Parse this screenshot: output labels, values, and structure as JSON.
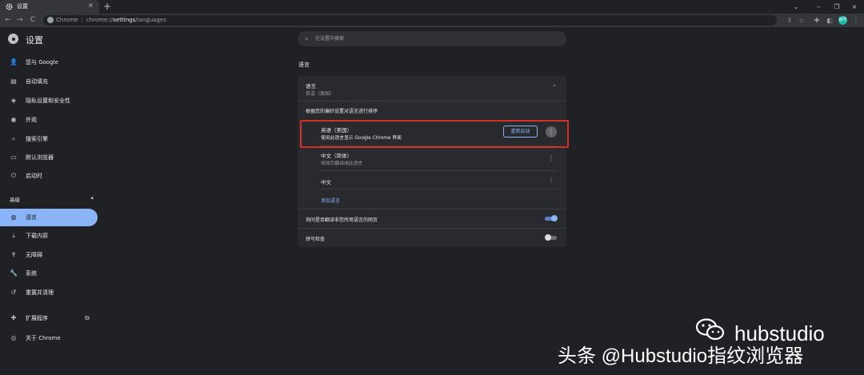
{
  "tab": {
    "title": "设置",
    "close": "×",
    "new_tab": "+"
  },
  "window_controls": {
    "dropdown": "⌄",
    "minimize": "–",
    "restore": "❐",
    "close": "×"
  },
  "toolbar": {
    "back": "←",
    "forward": "→",
    "reload": "C",
    "site_label": "Chrome",
    "url_prefix": "chrome://",
    "url_path": "settings",
    "url_rest": "/languages",
    "avatar_text": "账号"
  },
  "header": {
    "title": "设置",
    "search_placeholder": "在设置中搜索"
  },
  "sidebar": {
    "items": [
      {
        "label": "您与 Google",
        "icon": "person-icon",
        "glyph": "👤"
      },
      {
        "label": "自动填充",
        "icon": "clipboard-icon",
        "glyph": "▤"
      },
      {
        "label": "隐私设置和安全性",
        "icon": "shield-icon",
        "glyph": "◈"
      },
      {
        "label": "外观",
        "icon": "palette-icon",
        "glyph": "◉"
      },
      {
        "label": "搜索引擎",
        "icon": "search-icon",
        "glyph": "⌕"
      },
      {
        "label": "默认浏览器",
        "icon": "browser-icon",
        "glyph": "▭"
      },
      {
        "label": "启动时",
        "icon": "power-icon",
        "glyph": "⏻"
      }
    ],
    "advanced_label": "高级",
    "advanced_caret": "▴",
    "advanced_items": [
      {
        "label": "语言",
        "icon": "globe-icon",
        "glyph": "◍"
      },
      {
        "label": "下载内容",
        "icon": "download-icon",
        "glyph": "⤓"
      },
      {
        "label": "无障碍",
        "icon": "accessibility-icon",
        "glyph": "✝"
      },
      {
        "label": "系统",
        "icon": "wrench-icon",
        "glyph": "🔧"
      },
      {
        "label": "重置并清理",
        "icon": "history-icon",
        "glyph": "↺"
      }
    ],
    "extensions_label": "扩展程序",
    "extensions_glyph": "✚",
    "external_glyph": "⧉",
    "about_label": "关于 Chrome",
    "about_glyph": "◎"
  },
  "main": {
    "section_title": "语言",
    "card": {
      "title": "语言",
      "subtitle": "英语（美国）",
      "collapse_glyph": "⌃",
      "order_label": "根据您的偏好设置对语言进行排序",
      "languages": [
        {
          "name": "英语（美国）",
          "desc": "使用此语言显示 Google Chrome 界面",
          "action": "重新启动"
        },
        {
          "name": "中文（简体）",
          "desc": "将网页翻译成此语言"
        },
        {
          "name": "中文"
        }
      ],
      "more_glyph": "⋮",
      "add_language": "添加语言",
      "translate_label": "询问是否翻译非您所用语言的网页",
      "translate_on": true,
      "spellcheck_label": "拼写检查",
      "spellcheck_on": false
    }
  },
  "watermark": {
    "logo_text": "hubstudio",
    "caption": "头条 @Hubstudio指纹浏览器"
  },
  "colors": {
    "accent": "#8ab4f8",
    "highlight": "#d93025",
    "background": "#202124",
    "card": "#292a2d"
  }
}
